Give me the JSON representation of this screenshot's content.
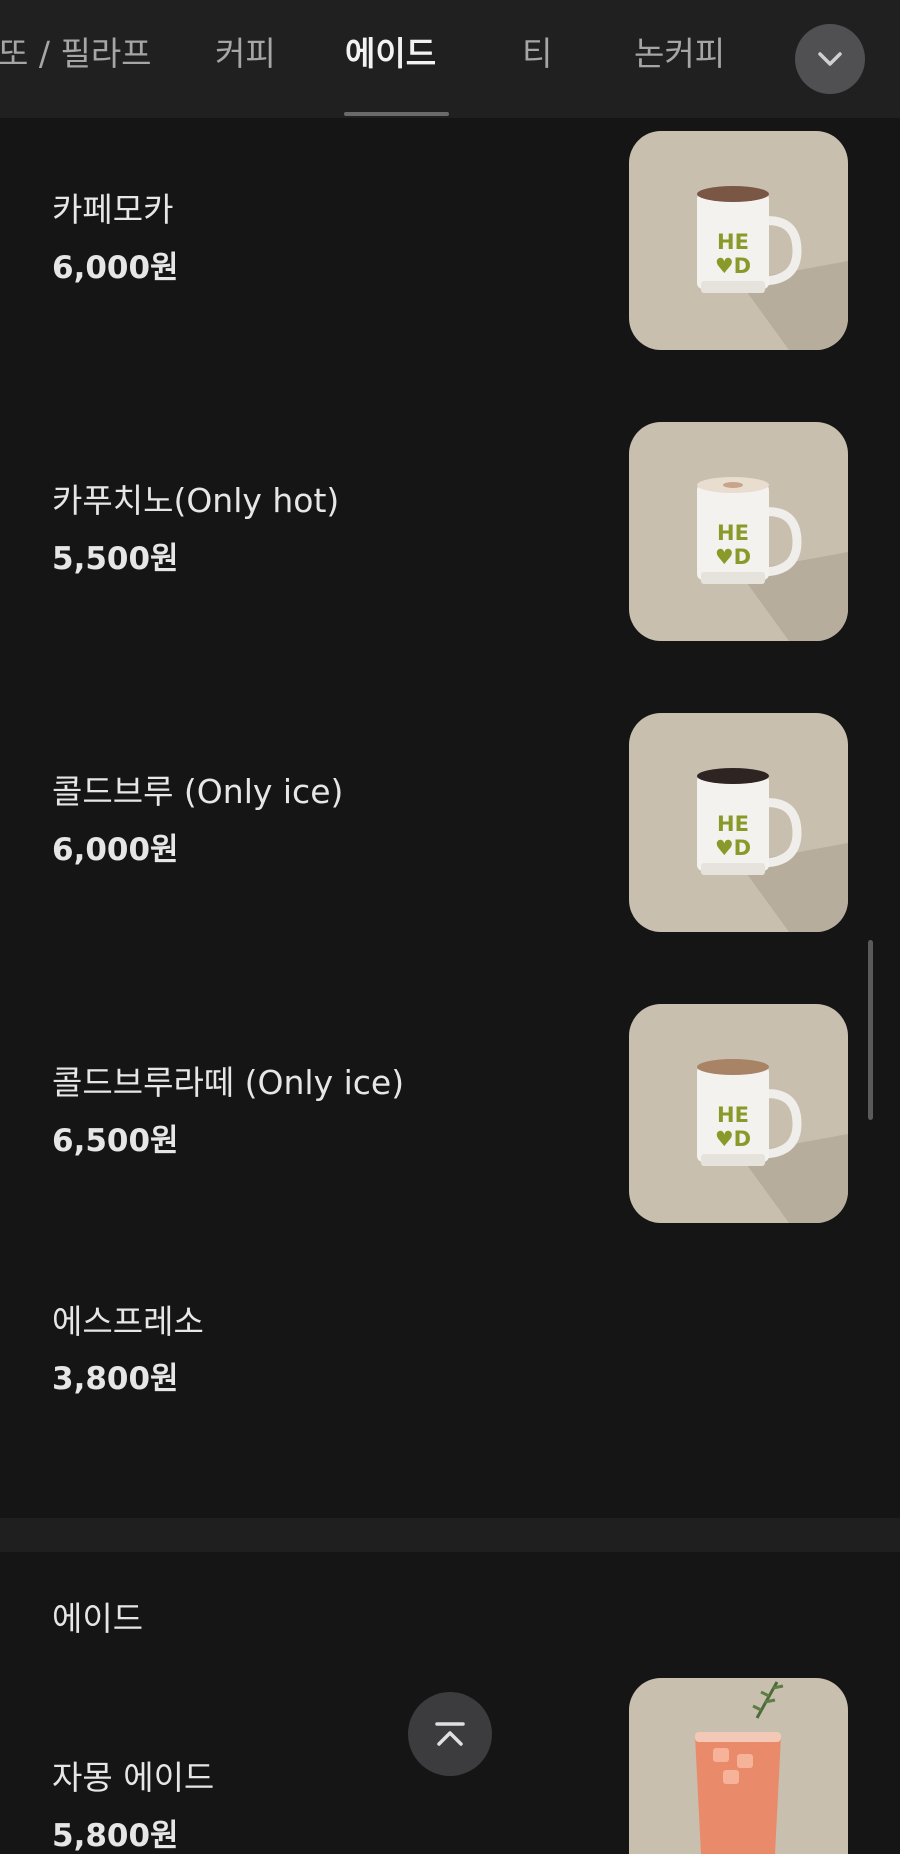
{
  "tabs": [
    {
      "label": "또 / 필라프"
    },
    {
      "label": "커피"
    },
    {
      "label": "에이드",
      "active": true
    },
    {
      "label": "티"
    },
    {
      "label": "논커피"
    }
  ],
  "coffee_items": [
    {
      "name": "카페모카",
      "price": "6,000원",
      "thumbnail": "mug-mocha"
    },
    {
      "name": "카푸치노(Only hot)",
      "price": "5,500원",
      "thumbnail": "mug-cappuccino"
    },
    {
      "name": "콜드브루 (Only ice)",
      "price": "6,000원",
      "thumbnail": "mug-coldbrew"
    },
    {
      "name": "콜드브루라떼 (Only ice)",
      "price": "6,500원",
      "thumbnail": "mug-coldbrew-latte"
    },
    {
      "name": "에스프레소",
      "price": "3,800원"
    }
  ],
  "ade_section": {
    "title": "에이드",
    "items": [
      {
        "name": "자몽 에이드",
        "price": "5,800원",
        "thumbnail": "grapefruit-ade-glass"
      }
    ]
  },
  "mug_print": "HE♥D",
  "colors": {
    "background": "#151516",
    "tabbar": "#202021",
    "thumbnail_bg": "#c9bfae",
    "mug_text": "#8a9a2a"
  }
}
